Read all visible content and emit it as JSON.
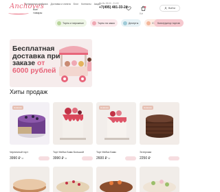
{
  "header": {
    "logo_text": "Anchoves",
    "all_products": "Все товары",
    "nav": [
      "Кулинарная фабрика",
      "Доставка и оплата",
      "Блог",
      "Контакты",
      "Акции"
    ],
    "hours": "Пн-Вс 09:00 - 21:00",
    "phone": "+7(495) 481-33-24",
    "cart_price": "0 ₽",
    "login_label": "Войти"
  },
  "categories": [
    {
      "label": "Торты и пирожные",
      "icon": "cake-icon"
    },
    {
      "label": "Торты на заказ",
      "icon": "tiered-cake-icon"
    },
    {
      "label": "Десерты",
      "icon": "dessert-icon"
    },
    {
      "label": "Свежее к завтраку",
      "icon": "croissant-icon"
    }
  ],
  "construct_label": "Конструктор тортов",
  "banner": {
    "line1": "Бесплатная",
    "line2": "доставка при",
    "line3": "заказе",
    "accent": "от",
    "line4": "6000 рублей"
  },
  "section_title": "Хиты продаж",
  "products": [
    {
      "name": "Черничный торт",
      "price": "3990 ₽",
      "unit": "/кг",
      "badge": "Новинка"
    },
    {
      "name": "Торт Мейчи Бамк Большой",
      "price": "3990 ₽",
      "unit": "/кг",
      "badge": ""
    },
    {
      "name": "Торт Мейчи Бамк",
      "price": "2600 ₽",
      "unit": "/кг",
      "badge": "Новинка"
    },
    {
      "name": "Эстерхази",
      "price": "2250 ₽",
      "unit": "",
      "badge": "Новинка"
    }
  ],
  "colors": {
    "accent": "#e8657a",
    "banner_bg": "#f6ecec"
  }
}
